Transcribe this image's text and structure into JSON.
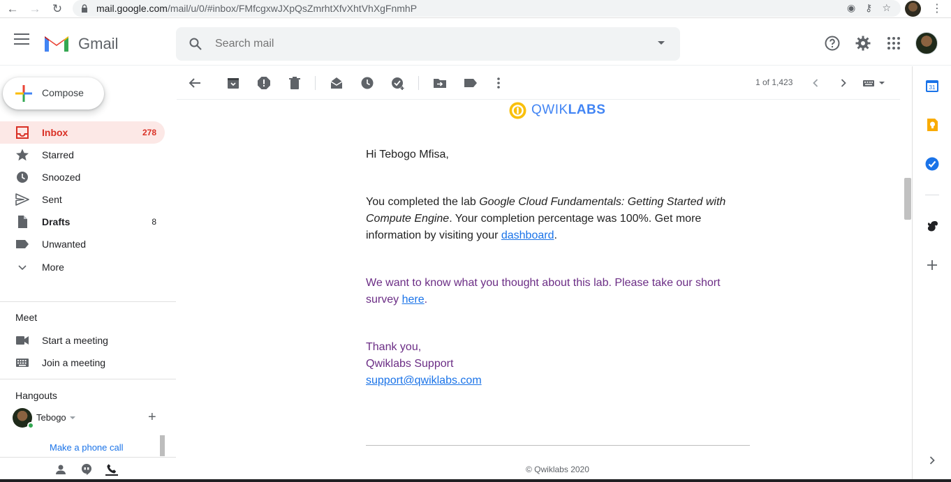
{
  "browser": {
    "url_host": "mail.google.com",
    "url_path": "/mail/u/0/#inbox/FMfcgxwJXpQsZmrhtXfvXhtVhXgFnmhP"
  },
  "header": {
    "app_name": "Gmail",
    "search_placeholder": "Search mail"
  },
  "sidebar": {
    "compose_label": "Compose",
    "items": [
      {
        "label": "Inbox",
        "count": "278",
        "icon": "inbox-icon"
      },
      {
        "label": "Starred",
        "count": "",
        "icon": "star-icon"
      },
      {
        "label": "Snoozed",
        "count": "",
        "icon": "clock-icon"
      },
      {
        "label": "Sent",
        "count": "",
        "icon": "send-icon"
      },
      {
        "label": "Drafts",
        "count": "8",
        "icon": "draft-icon"
      },
      {
        "label": "Unwanted",
        "count": "",
        "icon": "label-icon"
      },
      {
        "label": "More",
        "count": "",
        "icon": "chevron-down-icon"
      }
    ],
    "meet": {
      "title": "Meet",
      "start": "Start a meeting",
      "join": "Join a meeting"
    },
    "hangouts": {
      "title": "Hangouts",
      "user": "Tebogo",
      "phone_call": "Make a phone call"
    }
  },
  "toolbar": {
    "pager": "1 of 1,423"
  },
  "message": {
    "logo_text_light": "QWIK",
    "logo_text_bold": "LABS",
    "greeting": "Hi Tebogo Mfisa,",
    "p1_pre": "You completed the lab ",
    "p1_lab": "Google Cloud Fundamentals: Getting Started with Compute Engine",
    "p1_mid": ". Your completion percentage was 100%. Get more information by visiting your ",
    "p1_link": "dashboard",
    "p1_end": ".",
    "p2_pre": "We want to know what you thought about this lab. Please take our short survey ",
    "p2_link": "here",
    "p2_end": ".",
    "thanks": "Thank you,",
    "signature": "Qwiklabs Support",
    "email": "support@qwiklabs.com",
    "copyright": "© Qwiklabs 2020"
  },
  "right_panel": {
    "calendar_day": "31"
  },
  "colors": {
    "inbox_active_bg": "#fce8e6",
    "inbox_active_text": "#d93025",
    "link": "#1a73e8",
    "purple_text": "#6b2d85",
    "qwiklabs_blue": "#4285f4",
    "qwiklabs_yellow": "#f9c00c"
  }
}
